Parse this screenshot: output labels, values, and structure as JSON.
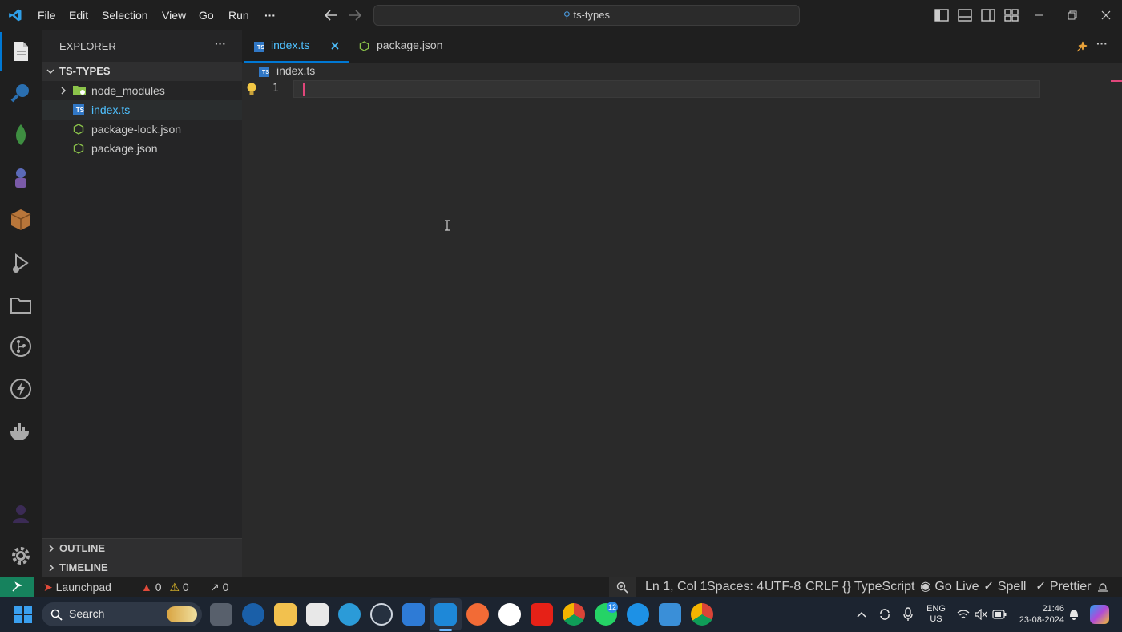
{
  "menu": {
    "items": [
      "File",
      "Edit",
      "Selection",
      "View",
      "Go",
      "Run"
    ],
    "more": "···"
  },
  "command_center": {
    "text": "ts-types"
  },
  "sidebar": {
    "title": "EXPLORER",
    "more": "···",
    "project": "TS-TYPES",
    "items": [
      {
        "label": "node_modules",
        "type": "folder"
      },
      {
        "label": "index.ts",
        "type": "ts",
        "active": true
      },
      {
        "label": "package-lock.json",
        "type": "json"
      },
      {
        "label": "package.json",
        "type": "json"
      }
    ],
    "outline": "OUTLINE",
    "timeline": "TIMELINE"
  },
  "tabs": [
    {
      "label": "index.ts",
      "active": true
    },
    {
      "label": "package.json",
      "active": false
    }
  ],
  "breadcrumb": {
    "file": "index.ts"
  },
  "editor": {
    "line_number": "1"
  },
  "status": {
    "launchpad": "Launchpad",
    "errors": "0",
    "warnings": "0",
    "ports": "0",
    "position": "Ln 1, Col 1",
    "spaces": "Spaces: 4",
    "encoding": "UTF-8",
    "eol": "CRLF",
    "language": "TypeScript",
    "golive": "Go Live",
    "spell": "Spell",
    "prettier": "Prettier"
  },
  "taskbar": {
    "search": "Search",
    "lang_top": "ENG",
    "lang_bottom": "US",
    "time": "21:46",
    "date": "23-08-2024",
    "whatsapp_badge": "12"
  },
  "colors": {
    "accent": "#0078d4",
    "active_tab_text": "#4fc1ff",
    "cursor": "#e0467a",
    "status_bg": "#1f1f1f"
  }
}
